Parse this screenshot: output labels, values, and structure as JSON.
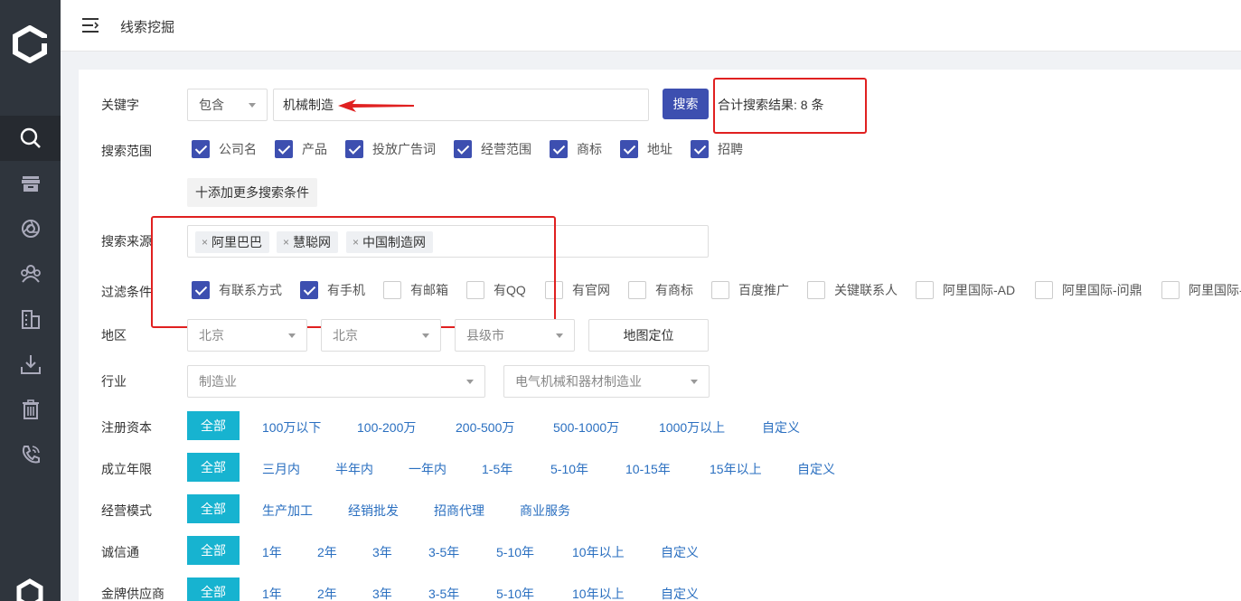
{
  "header": {
    "title": "线索挖掘"
  },
  "sidebar": {
    "items": [
      {
        "icon": "search-icon"
      },
      {
        "icon": "archive-icon"
      },
      {
        "icon": "aperture-icon"
      },
      {
        "icon": "team-icon"
      },
      {
        "icon": "building-icon"
      },
      {
        "icon": "download-icon"
      },
      {
        "icon": "trash-icon"
      },
      {
        "icon": "phone-icon"
      }
    ]
  },
  "keyword": {
    "label": "关键字",
    "mode": "包含",
    "value": "机械制造",
    "search_label": "搜索",
    "result_text": "合计搜索结果:  8  条"
  },
  "scope": {
    "label": "搜索范围",
    "options": [
      "公司名",
      "产品",
      "投放广告词",
      "经营范围",
      "商标",
      "地址",
      "招聘"
    ],
    "add_more": "十添加更多搜索条件"
  },
  "source": {
    "label": "搜索来源",
    "tags": [
      "阿里巴巴",
      "慧聪网",
      "中国制造网"
    ]
  },
  "filter": {
    "label": "过滤条件",
    "options": [
      {
        "label": "有联系方式",
        "checked": true
      },
      {
        "label": "有手机",
        "checked": true
      },
      {
        "label": "有邮箱",
        "checked": false
      },
      {
        "label": "有QQ",
        "checked": false
      },
      {
        "label": "有官网",
        "checked": false
      },
      {
        "label": "有商标",
        "checked": false
      },
      {
        "label": "百度推广",
        "checked": false
      },
      {
        "label": "关键联系人",
        "checked": false
      },
      {
        "label": "阿里国际-AD",
        "checked": false
      },
      {
        "label": "阿里国际-问鼎",
        "checked": false
      },
      {
        "label": "阿里国际-",
        "checked": false
      }
    ]
  },
  "region": {
    "label": "地区",
    "province": "北京",
    "city": "北京",
    "county": "县级市",
    "map_label": "地图定位"
  },
  "industry": {
    "label": "行业",
    "primary": "制造业",
    "secondary": "电气机械和器材制造业"
  },
  "capital": {
    "label": "注册资本",
    "all": "全部",
    "options": [
      "100万以下",
      "100-200万",
      "200-500万",
      "500-1000万",
      "1000万以上",
      "自定义"
    ]
  },
  "age": {
    "label": "成立年限",
    "all": "全部",
    "options": [
      "三月内",
      "半年内",
      "一年内",
      "1-5年",
      "5-10年",
      "10-15年",
      "15年以上",
      "自定义"
    ]
  },
  "mode": {
    "label": "经营模式",
    "all": "全部",
    "options": [
      "生产加工",
      "经销批发",
      "招商代理",
      "商业服务"
    ]
  },
  "trust": {
    "label": "诚信通",
    "all": "全部",
    "options": [
      "1年",
      "2年",
      "3年",
      "3-5年",
      "5-10年",
      "10年以上",
      "自定义"
    ]
  },
  "gold": {
    "label": "金牌供应商",
    "all": "全部",
    "options": [
      "1年",
      "2年",
      "3年",
      "3-5年",
      "5-10年",
      "10年以上",
      "自定义"
    ]
  },
  "colors": {
    "primary": "#3d4fb0",
    "accent": "#17b3d0",
    "link": "#2a6fc0",
    "highlight": "#e02020"
  }
}
